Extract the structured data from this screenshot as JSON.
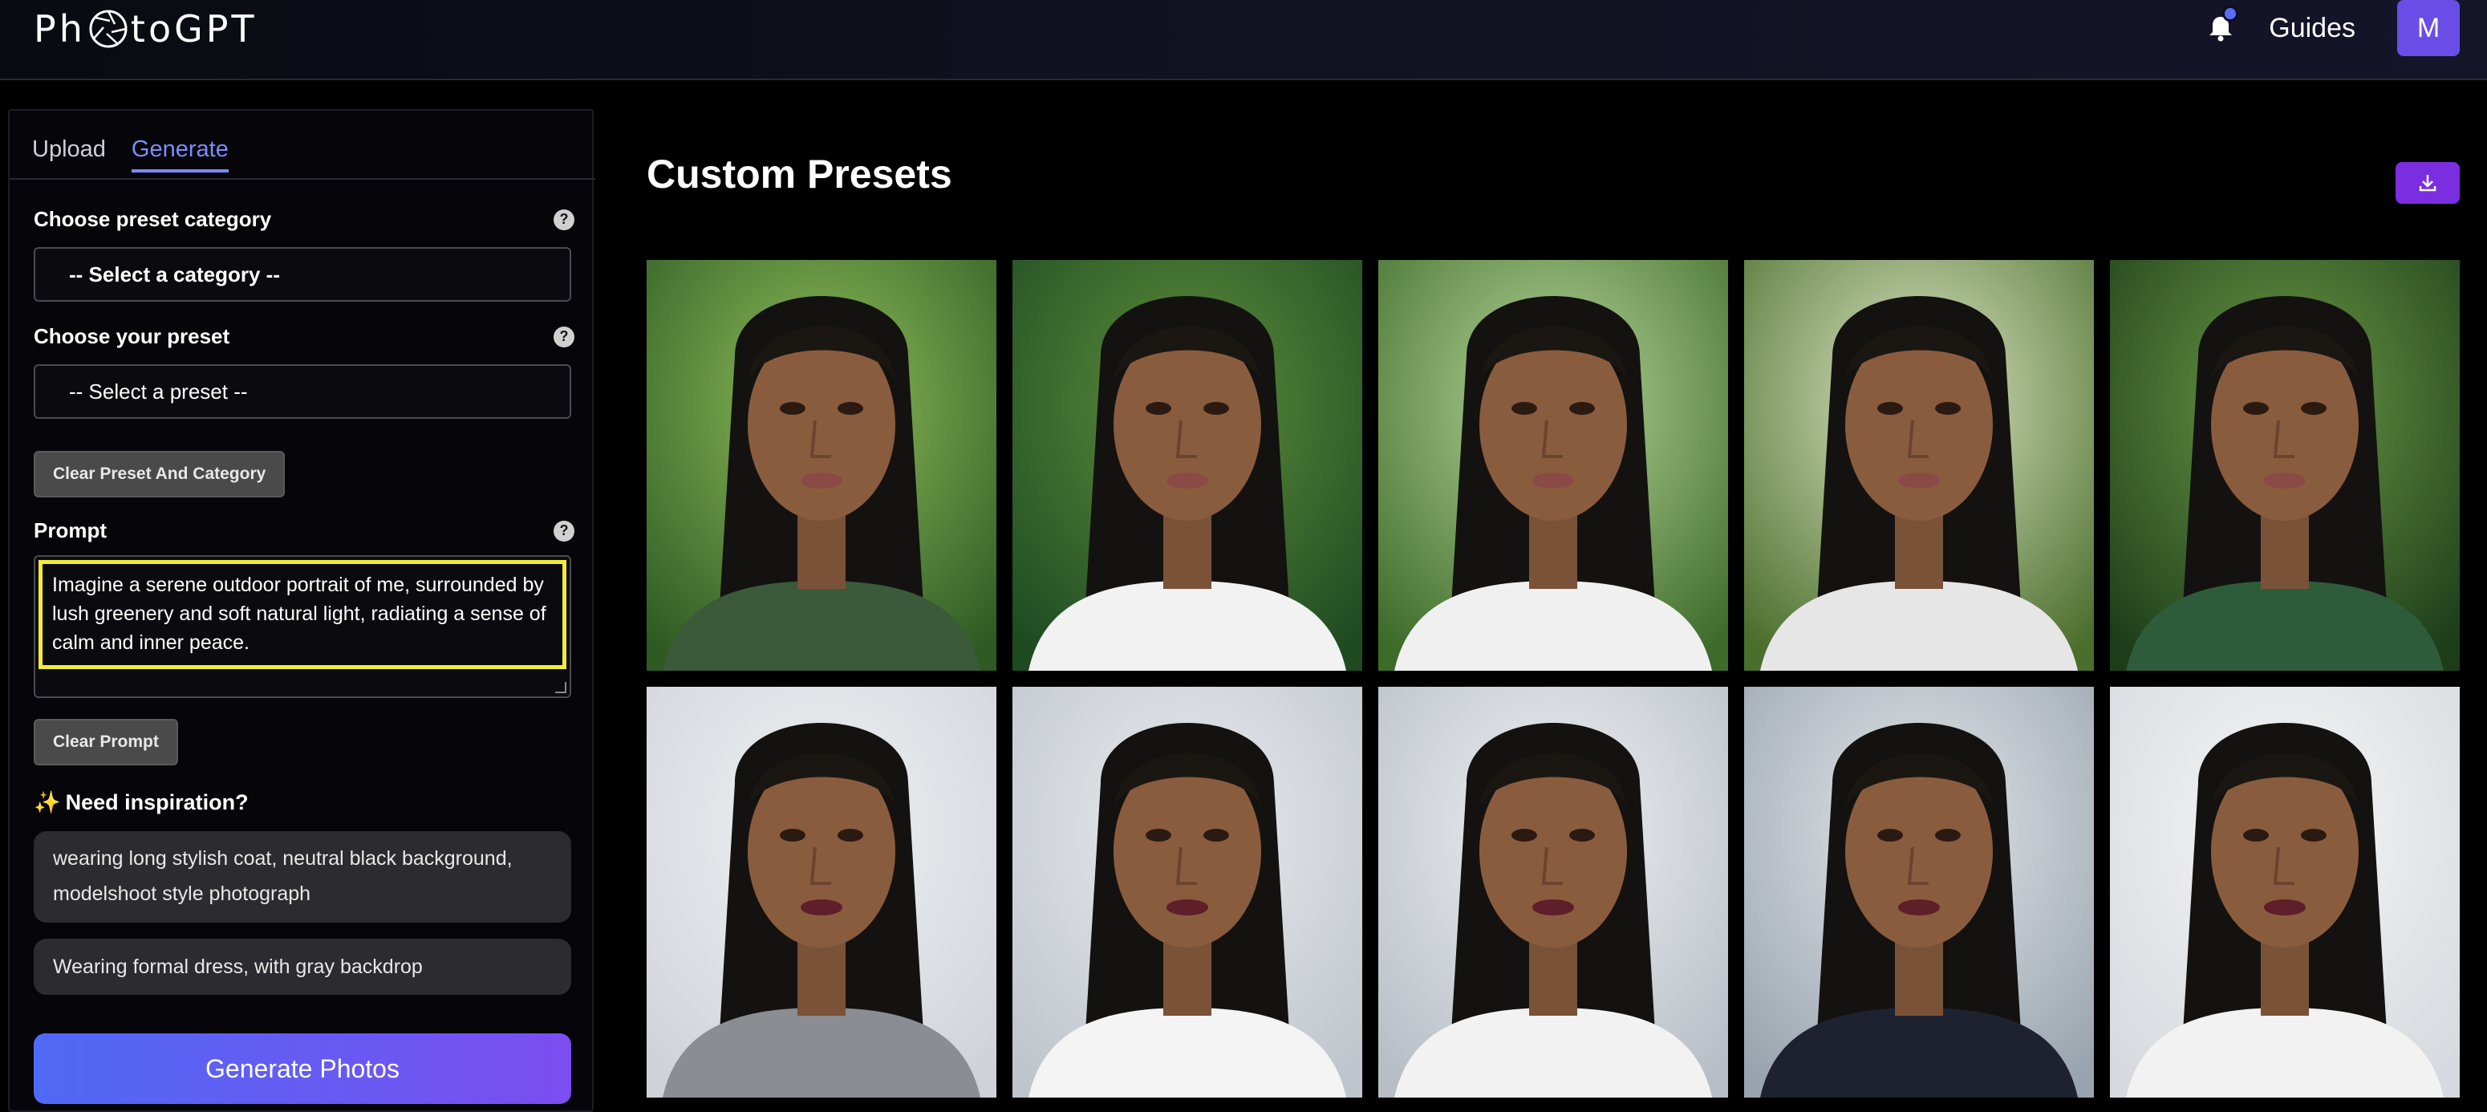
{
  "header": {
    "logo_text_pre": "Ph",
    "logo_text_post": "toGPT",
    "guides_label": "Guides",
    "avatar_initial": "M",
    "notification_dot_color": "#5b6bff",
    "avatar_color": "#6a4de6"
  },
  "tabs": [
    {
      "label": "Upload",
      "active": false
    },
    {
      "label": "Generate",
      "active": true
    }
  ],
  "form": {
    "category_label": "Choose preset category",
    "category_value": "-- Select a category --",
    "preset_label": "Choose your preset",
    "preset_value": "-- Select a preset --",
    "clear_preset_label": "Clear Preset And Category",
    "prompt_label": "Prompt",
    "prompt_value": "Imagine a serene outdoor portrait of me, surrounded by lush greenery and soft natural light, radiating a sense of calm and inner peace.",
    "clear_prompt_label": "Clear Prompt",
    "help_glyph": "?"
  },
  "inspiration": {
    "title": "Need inspiration?",
    "icon": "sparkles-icon",
    "suggestions": [
      "wearing long stylish coat, neutral black background, modelshoot style photograph",
      "Wearing formal dress, with gray backdrop"
    ]
  },
  "generate_label": "Generate Photos",
  "main": {
    "title": "Custom Presets",
    "download_icon": "download-icon",
    "accent_color": "#7a2ee0"
  },
  "gallery": {
    "rows": [
      {
        "scene": "outdoor-greenery",
        "count": 5
      },
      {
        "scene": "office-cityscape",
        "count": 5
      }
    ]
  }
}
